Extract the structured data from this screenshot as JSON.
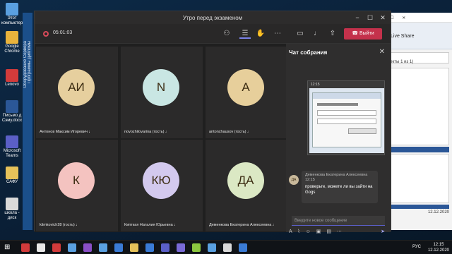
{
  "desktop": {
    "icons": [
      {
        "label": "Этот компьютер",
        "color": "#5aa0e0"
      },
      {
        "label": "Google Chrome",
        "color": "#e8b33c"
      },
      {
        "label": "Lenovo",
        "color": "#d23b3b"
      },
      {
        "label": "Письмо д Сэму.docx",
        "color": "#2b5797"
      },
      {
        "label": "Microsoft Teams",
        "color": "#5b5fc7"
      },
      {
        "label": "САФУ",
        "color": "#e6c25a"
      },
      {
        "label": "школа - диск",
        "color": "#d9d9d9"
      }
    ],
    "left_vertical_texts": [
      "Оборудование Сервера",
      "Программы Дипломы"
    ]
  },
  "background_app": {
    "live_share": "Live Share",
    "pages": "ректы 1 из 1)",
    "date": "12.12.2020"
  },
  "window": {
    "title": "Утро перед экзаменом",
    "controls": [
      "−",
      "☐",
      "✕"
    ],
    "call_time": "05:01:03",
    "leave_label": "Выйти"
  },
  "participants": [
    {
      "initials": "АИ",
      "name": "Антонов Максим Игоревич",
      "color": "#e6cf9e"
    },
    {
      "initials": "N",
      "name": "novozhilovarina (гость)",
      "color": "#c9e6e3"
    },
    {
      "initials": "А",
      "name": "antonchausov (гость)",
      "color": "#e7cf9b"
    },
    {
      "initials": "К",
      "name": "klimkovich28 (гость)",
      "color": "#f4c3c0"
    },
    {
      "initials": "КЮ",
      "name": "Кипткая Наталия Юрьевна",
      "color": "#d3c9ee"
    },
    {
      "initials": "ДА",
      "name": "Деменкова Екатерина Алексеевна",
      "color": "#dbe8c4"
    }
  ],
  "chat": {
    "title": "Чат собрания",
    "shot_time": "12:15",
    "message": {
      "author": "Деменкова Екатерина Алексеевна",
      "time": "12:15",
      "text": "проверьте, можете ли вы зайти на Gogs"
    },
    "input_placeholder": "Введите новое сообщение"
  },
  "taskbar": {
    "lang": "РУС",
    "time": "12:15",
    "date": "12.12.2020",
    "icon_colors": [
      "#d23b3b",
      "#e8e8e8",
      "#d23b3b",
      "#5aa0e0",
      "#8a4fc6",
      "#5aa0e0",
      "#3a7bd5",
      "#e6c25a",
      "#3a7bd5",
      "#5b5fc7",
      "#7a6ad6",
      "#8cc63f",
      "#5aa0e0",
      "#d9d9d9",
      "#3a7bd5"
    ]
  }
}
